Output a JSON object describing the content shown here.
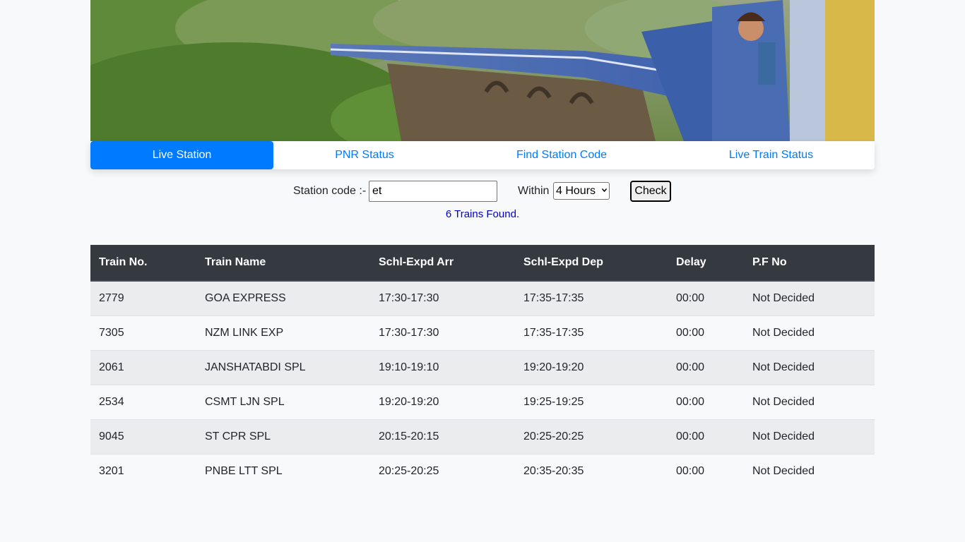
{
  "tabs": [
    {
      "label": "Live Station",
      "active": true
    },
    {
      "label": "PNR Status",
      "active": false
    },
    {
      "label": "Find Station Code",
      "active": false
    },
    {
      "label": "Live Train Status",
      "active": false
    }
  ],
  "search": {
    "station_label": "Station code :-",
    "station_value": "et",
    "within_label": "Within",
    "within_value": "4 Hours",
    "check_label": "Check"
  },
  "result_text": "6 Trains Found.",
  "table": {
    "headers": [
      "Train No.",
      "Train Name",
      "Schl-Expd Arr",
      "Schl-Expd Dep",
      "Delay",
      "P.F No"
    ],
    "rows": [
      [
        "2779",
        "GOA EXPRESS",
        "17:30-17:30",
        "17:35-17:35",
        "00:00",
        "Not Decided"
      ],
      [
        "7305",
        "NZM LINK EXP",
        "17:30-17:30",
        "17:35-17:35",
        "00:00",
        "Not Decided"
      ],
      [
        "2061",
        "JANSHATABDI SPL",
        "19:10-19:10",
        "19:20-19:20",
        "00:00",
        "Not Decided"
      ],
      [
        "2534",
        "CSMT LJN SPL",
        "19:20-19:20",
        "19:25-19:25",
        "00:00",
        "Not Decided"
      ],
      [
        "9045",
        "ST CPR SPL",
        "20:15-20:15",
        "20:25-20:25",
        "00:00",
        "Not Decided"
      ],
      [
        "3201",
        "PNBE LTT SPL",
        "20:25-20:25",
        "20:35-20:35",
        "00:00",
        "Not Decided"
      ]
    ]
  },
  "colors": {
    "accent": "#007bff",
    "header_bg": "#343a40",
    "result_text": "#0000cc"
  }
}
